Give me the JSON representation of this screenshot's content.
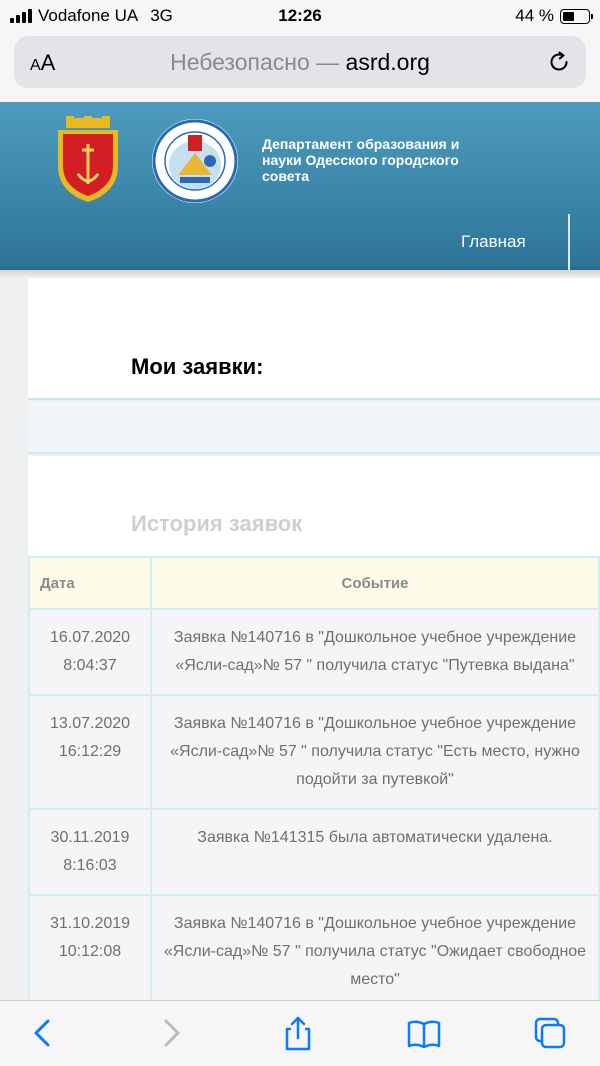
{
  "status_bar": {
    "carrier": "Vodafone UA",
    "network": "3G",
    "time": "12:26",
    "battery_text": "44 %",
    "battery_level": 0.44
  },
  "browser": {
    "text_size_label": "AA",
    "url_insecure": "Небезопасно —",
    "url_domain": "asrd.org",
    "reload_icon": "reload-icon"
  },
  "site_header": {
    "department": "Департамент образования и науки Одесского городского совета",
    "nav_home": "Главная",
    "colors": {
      "header_blue": "#3b87ab",
      "coat_red": "#d21f26",
      "coat_gold": "#e8b923"
    }
  },
  "main": {
    "my_apps_heading": "Мои заявки:",
    "history_heading": "История заявок",
    "table": {
      "columns": [
        "Дата",
        "Событие"
      ],
      "rows": [
        {
          "date": "16.07.2020",
          "time": "8:04:37",
          "event": "Заявка №140716 в \"Дошкольное учебное учреждение «Ясли-сад»№ 57 \" получила статус \"Путевка выдана\""
        },
        {
          "date": "13.07.2020",
          "time": "16:12:29",
          "event": "Заявка №140716 в \"Дошкольное учебное учреждение «Ясли-сад»№ 57 \" получила статус \"Есть место, нужно подойти за путевкой\""
        },
        {
          "date": "30.11.2019",
          "time": "8:16:03",
          "event": "Заявка №141315 была автоматически удалена."
        },
        {
          "date": "31.10.2019",
          "time": "10:12:08",
          "event": "Заявка №140716 в \"Дошкольное учебное учреждение «Ясли-сад»№ 57 \" получила статус \"Ожидает свободное место\""
        }
      ]
    }
  },
  "toolbar": {
    "icons": [
      "back-icon",
      "forward-icon",
      "share-icon",
      "bookmarks-icon",
      "tabs-icon"
    ],
    "accent": "#0a7aff"
  }
}
